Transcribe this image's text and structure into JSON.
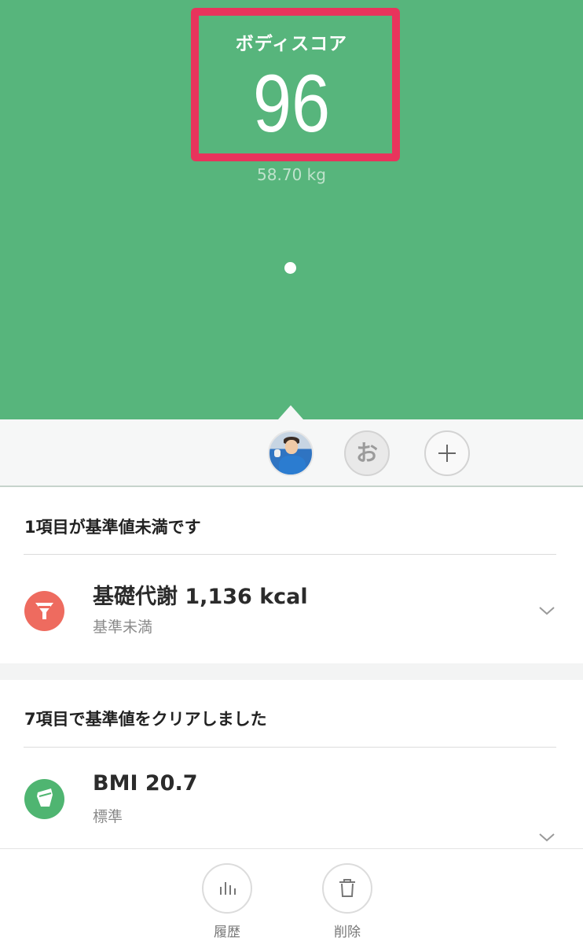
{
  "header": {
    "score_label": "ボディスコア",
    "score_value": "96",
    "weight": "58.70 kg"
  },
  "users": {
    "photo_avatar": "user-photo",
    "second_user_initial": "お",
    "add_label": "+"
  },
  "below_standard": {
    "title": "1項目が基準値未満です",
    "items": [
      {
        "name": "基礎代謝 1,136 kcal",
        "status": "基準未満",
        "icon": "funnel-icon",
        "color": "#ee6b5f"
      }
    ]
  },
  "cleared": {
    "title": "7項目で基準値をクリアしました",
    "items": [
      {
        "name": "BMI 20.7",
        "status": "標準",
        "icon": "cup-icon",
        "color": "#4fb571"
      }
    ]
  },
  "toolbar": {
    "history_label": "履歴",
    "delete_label": "削除"
  },
  "colors": {
    "hero_green": "#57b57c",
    "highlight_red": "#e8345c"
  }
}
